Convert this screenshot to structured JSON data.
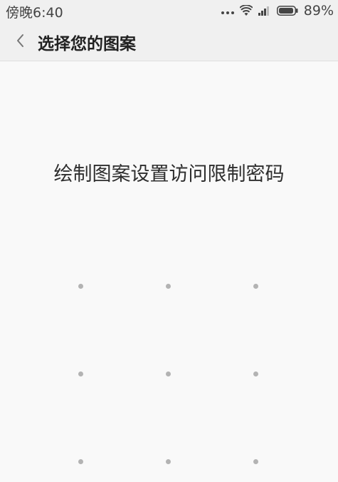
{
  "status_bar": {
    "time": "傍晚6:40",
    "battery_percent": "89%",
    "battery_level": 0.89,
    "icons": [
      "more-dots-icon",
      "wifi-icon",
      "signal-icon",
      "battery-icon"
    ]
  },
  "header": {
    "back_icon": "chevron-left-icon",
    "title": "选择您的图案"
  },
  "main": {
    "instruction": "绘制图案设置访问限制密码",
    "pattern_nodes": 9
  },
  "colors": {
    "background": "#f9f9f9",
    "bar_background": "#f0f0f0",
    "dot": "#b3b3b3",
    "text": "#2e2e2e"
  }
}
